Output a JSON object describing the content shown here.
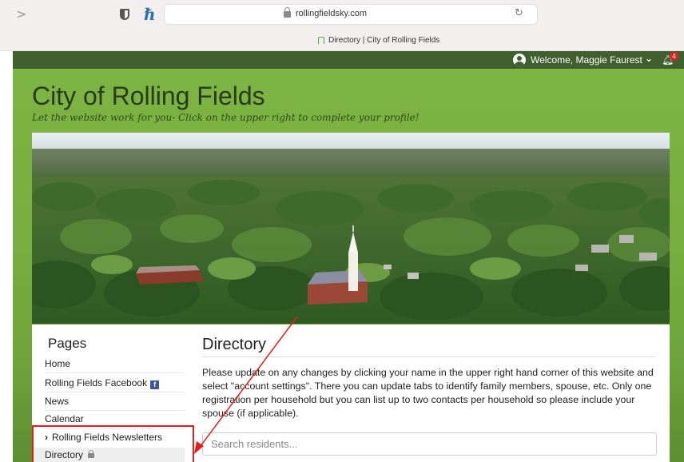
{
  "browser": {
    "url": "rollingfieldsky.com",
    "tab_title": "Directory | City of Rolling Fields",
    "forward_glyph": ">",
    "reload_glyph": "↻",
    "extension_glyph": "ℏ"
  },
  "topbar": {
    "welcome": "Welcome, Maggie Faurest",
    "notification_count": "4"
  },
  "site": {
    "title": "City of Rolling Fields",
    "tagline": "Let the website work for you- Click on the upper right to complete your profile!"
  },
  "sidebar": {
    "heading": "Pages",
    "items": [
      {
        "label": "Home"
      },
      {
        "label": "Rolling Fields Facebook"
      },
      {
        "label": "News"
      },
      {
        "label": "Calendar"
      },
      {
        "label": "Rolling Fields Newsletters"
      },
      {
        "label": "Directory"
      }
    ]
  },
  "main": {
    "title": "Directory",
    "body": "Please update on any changes by clicking your name in the upper right hand corner of this website and select \"account settings\".  There you can update tabs to identify family members, spouse, etc.  Only one registration per household but you can list up to two contacts per household so please include your spouse (if applicable).",
    "search_placeholder": "Search residents..."
  },
  "colors": {
    "page_green": "#7db443",
    "topbar_green": "#3f5f2e",
    "annotation_red": "#e0201c",
    "badge_red": "#e02424"
  }
}
